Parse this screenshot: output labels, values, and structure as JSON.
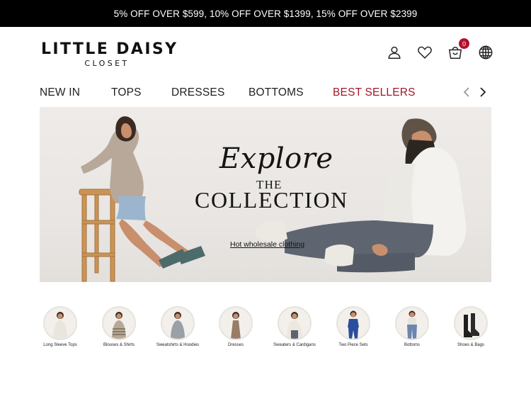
{
  "promo": {
    "text": "5% OFF OVER $599, 10% OFF OVER $1399, 15% OFF OVER $2399"
  },
  "brand": {
    "name": "LITTLE DAISY",
    "sub": "CLOSET"
  },
  "header_icons": [
    {
      "name": "account-icon"
    },
    {
      "name": "wishlist-icon"
    },
    {
      "name": "cart-icon",
      "badge": "0"
    },
    {
      "name": "language-icon"
    }
  ],
  "nav": {
    "items": [
      {
        "label": "NEW IN"
      },
      {
        "label": "TOPS"
      },
      {
        "label": "DRESSES"
      },
      {
        "label": "BOTTOMS"
      },
      {
        "label": "BEST SELLERS",
        "accent": "#a2172a"
      }
    ]
  },
  "hero": {
    "title_script": "Explore",
    "title_small": "THE",
    "title_big": "COLLECTION",
    "link": "Hot wholesale clothing"
  },
  "categories": [
    {
      "label": "Long Sleeve Tops",
      "color": "#e9e6dd"
    },
    {
      "label": "Blouses & Shirts",
      "color": "#b8a896"
    },
    {
      "label": "Sweatshirts & Hoodies",
      "color": "#9aa0a8"
    },
    {
      "label": "Dresses",
      "color": "#9a7c66"
    },
    {
      "label": "Sweaters & Cardigans",
      "color": "#ece8e0"
    },
    {
      "label": "Two Piece Sets",
      "color": "#2a4d9c"
    },
    {
      "label": "Bottoms",
      "color": "#6a86b0"
    },
    {
      "label": "Shoes & Bags",
      "color": "#1f1f1f"
    }
  ],
  "colors": {
    "accent": "#a2172a",
    "badge": "#b1102b",
    "promo_bg": "#000000"
  }
}
